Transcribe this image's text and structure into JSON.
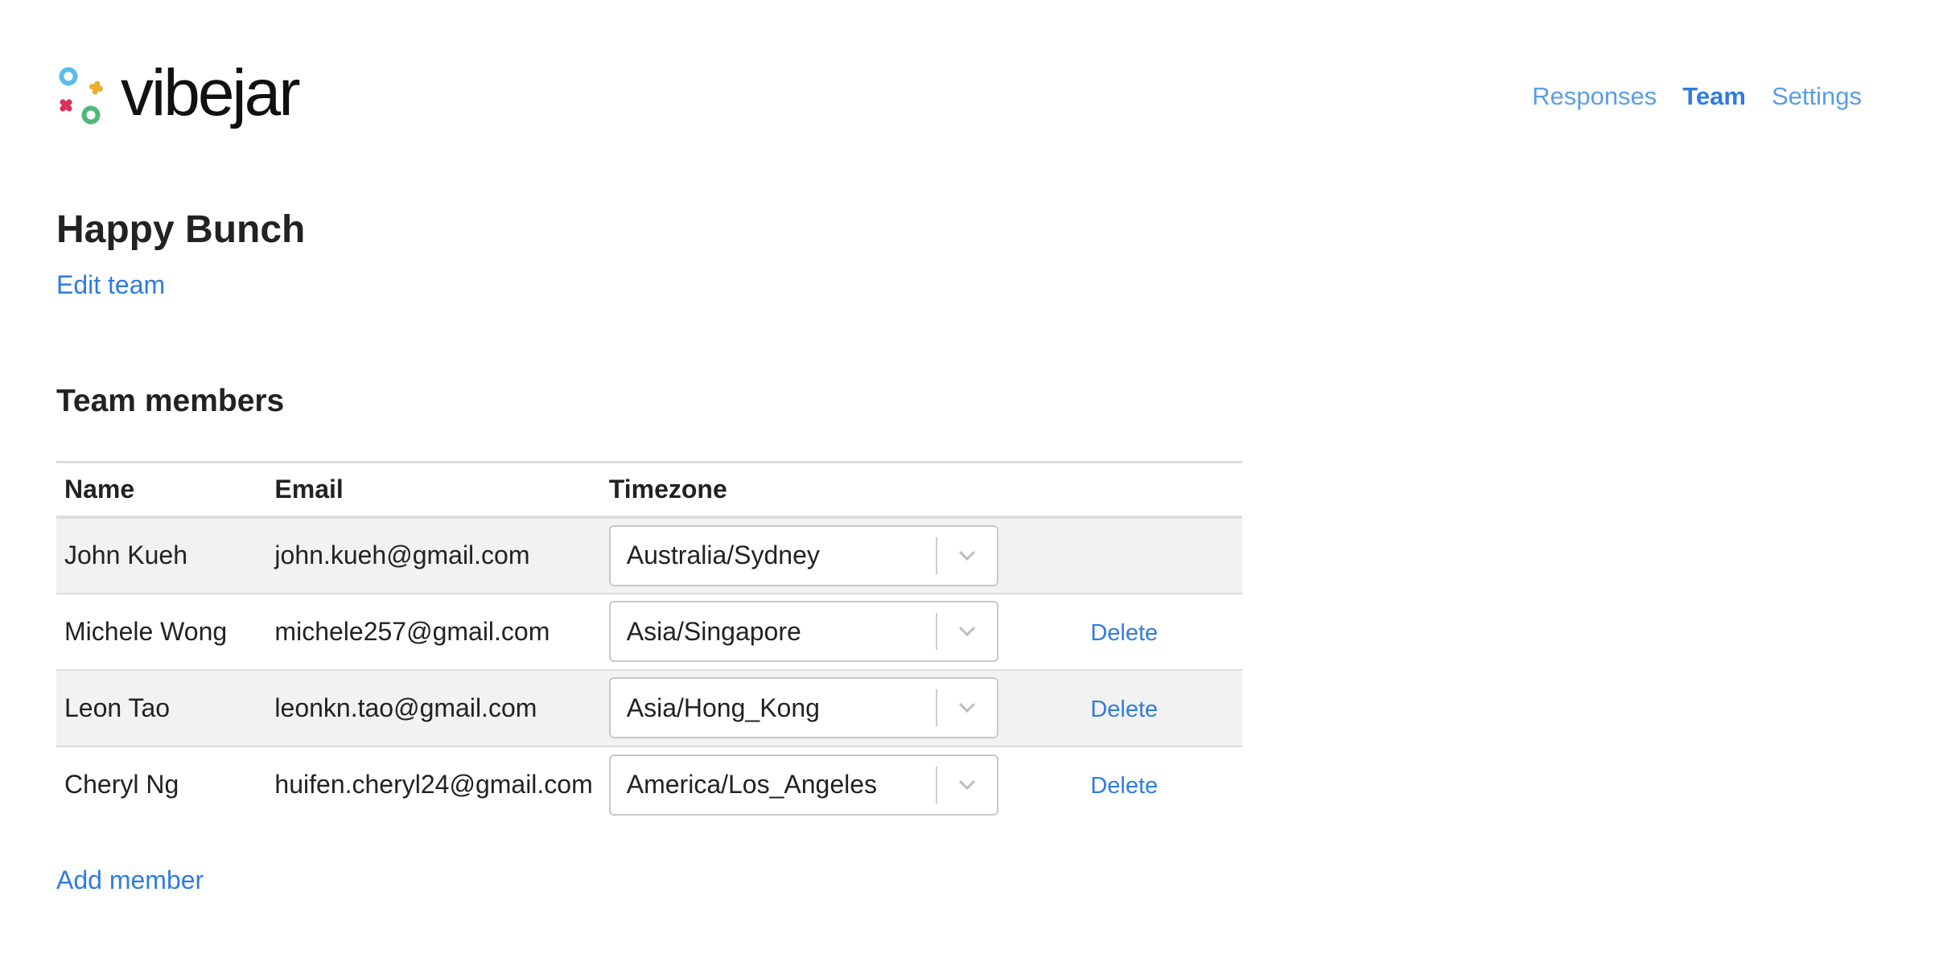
{
  "brand": {
    "name": "vibejar",
    "colors": {
      "blue": "#5bbde8",
      "yellow": "#e8b030",
      "red": "#d8325a",
      "green": "#4fb87a"
    }
  },
  "nav": {
    "items": [
      {
        "label": "Responses",
        "active": false
      },
      {
        "label": "Team",
        "active": true
      },
      {
        "label": "Settings",
        "active": false
      }
    ]
  },
  "team": {
    "name": "Happy Bunch",
    "edit_label": "Edit team"
  },
  "members": {
    "title": "Team members",
    "columns": [
      "Name",
      "Email",
      "Timezone",
      ""
    ],
    "rows": [
      {
        "name": "John Kueh",
        "email": "john.kueh@gmail.com",
        "timezone": "Australia/Sydney",
        "action": ""
      },
      {
        "name": "Michele Wong",
        "email": "michele257@gmail.com",
        "timezone": "Asia/Singapore",
        "action": "Delete"
      },
      {
        "name": "Leon Tao",
        "email": "leonkn.tao@gmail.com",
        "timezone": "Asia/Hong_Kong",
        "action": "Delete"
      },
      {
        "name": "Cheryl Ng",
        "email": "huifen.cheryl24@gmail.com",
        "timezone": "America/Los_Angeles",
        "action": "Delete"
      }
    ],
    "add_label": "Add member"
  },
  "icons": {
    "logo_mark": "vibejar-logo-mark",
    "select_arrow": "chevron-down-icon"
  },
  "colors": {
    "link": "#2f7ce0",
    "nav_link": "#5b9de6",
    "row_shade": "#f2f2f2",
    "border": "#dcdcdc"
  }
}
